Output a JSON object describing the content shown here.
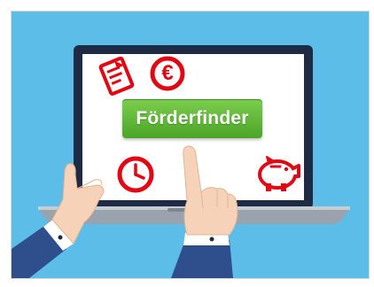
{
  "scene": {
    "button_label": "Förderfinder",
    "euro_symbol": "€"
  },
  "colors": {
    "background_sky": "#5cbde8",
    "laptop_bezel": "#1f2a44",
    "laptop_base": "#9aa3ad",
    "screen": "#ffffff",
    "button_green": "#5ab533",
    "icon_red": "#e30613",
    "sleeve_blue": "#2e4e8c",
    "skin": "#f6d3b8"
  },
  "icons": [
    "document-icon",
    "euro-coin-icon",
    "clock-icon",
    "piggy-bank-icon"
  ]
}
